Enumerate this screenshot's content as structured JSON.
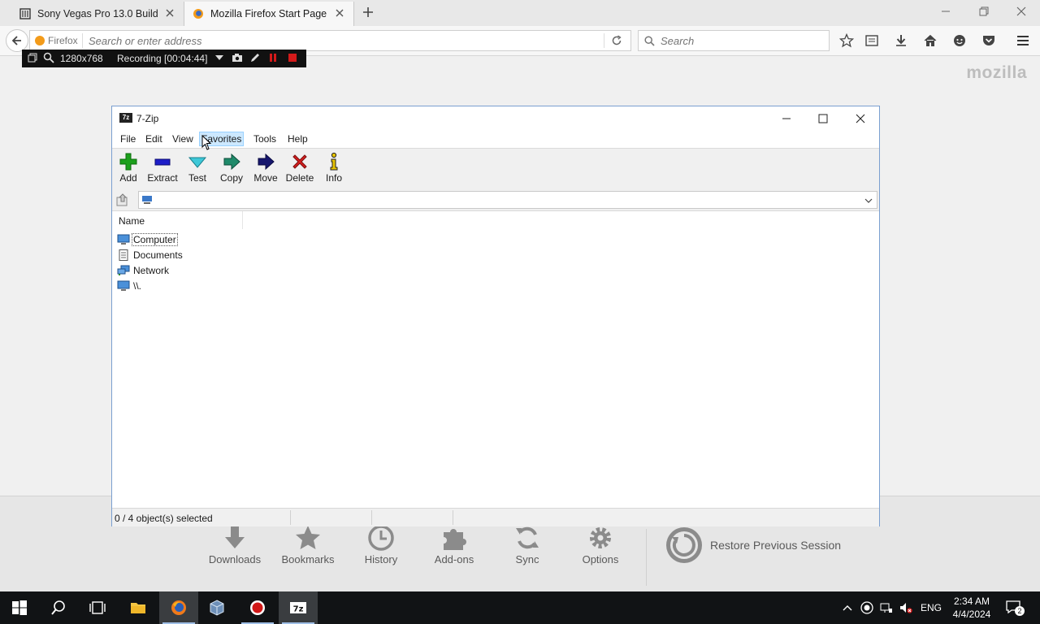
{
  "browser": {
    "tabs": [
      {
        "title": "Sony Vegas Pro 13.0 Build ...",
        "active": false
      },
      {
        "title": "Mozilla Firefox Start Page",
        "active": true
      }
    ],
    "identity_label": "Firefox",
    "address_placeholder": "Search or enter address",
    "search_placeholder": "Search",
    "brand_mark": "mozilla"
  },
  "recorder": {
    "resolution": "1280x768",
    "status": "Recording [00:04:44]"
  },
  "start_page": {
    "launch_items": [
      "Downloads",
      "Bookmarks",
      "History",
      "Add-ons",
      "Sync",
      "Options"
    ],
    "restore_label": "Restore Previous Session"
  },
  "zip_window": {
    "title": "7-Zip",
    "icon_label": "7z",
    "menu": [
      "File",
      "Edit",
      "View",
      "Favorites",
      "Tools",
      "Help"
    ],
    "toolbar": [
      "Add",
      "Extract",
      "Test",
      "Copy",
      "Move",
      "Delete",
      "Info"
    ],
    "address_value": "",
    "column_header": "Name",
    "items": [
      "Computer",
      "Documents",
      "Network",
      "\\\\."
    ],
    "status": "0 / 4 object(s) selected"
  },
  "taskbar": {
    "language": "ENG",
    "time": "2:34 AM",
    "date": "4/4/2024",
    "notification_count": "2",
    "zip_label": "7z"
  },
  "colors": {
    "accent": "#7a9fd0",
    "firefox_orange": "#f39b1a",
    "taskbar": "#111315",
    "add_green": "#1ca01c",
    "delete_red": "#d81f1f"
  }
}
